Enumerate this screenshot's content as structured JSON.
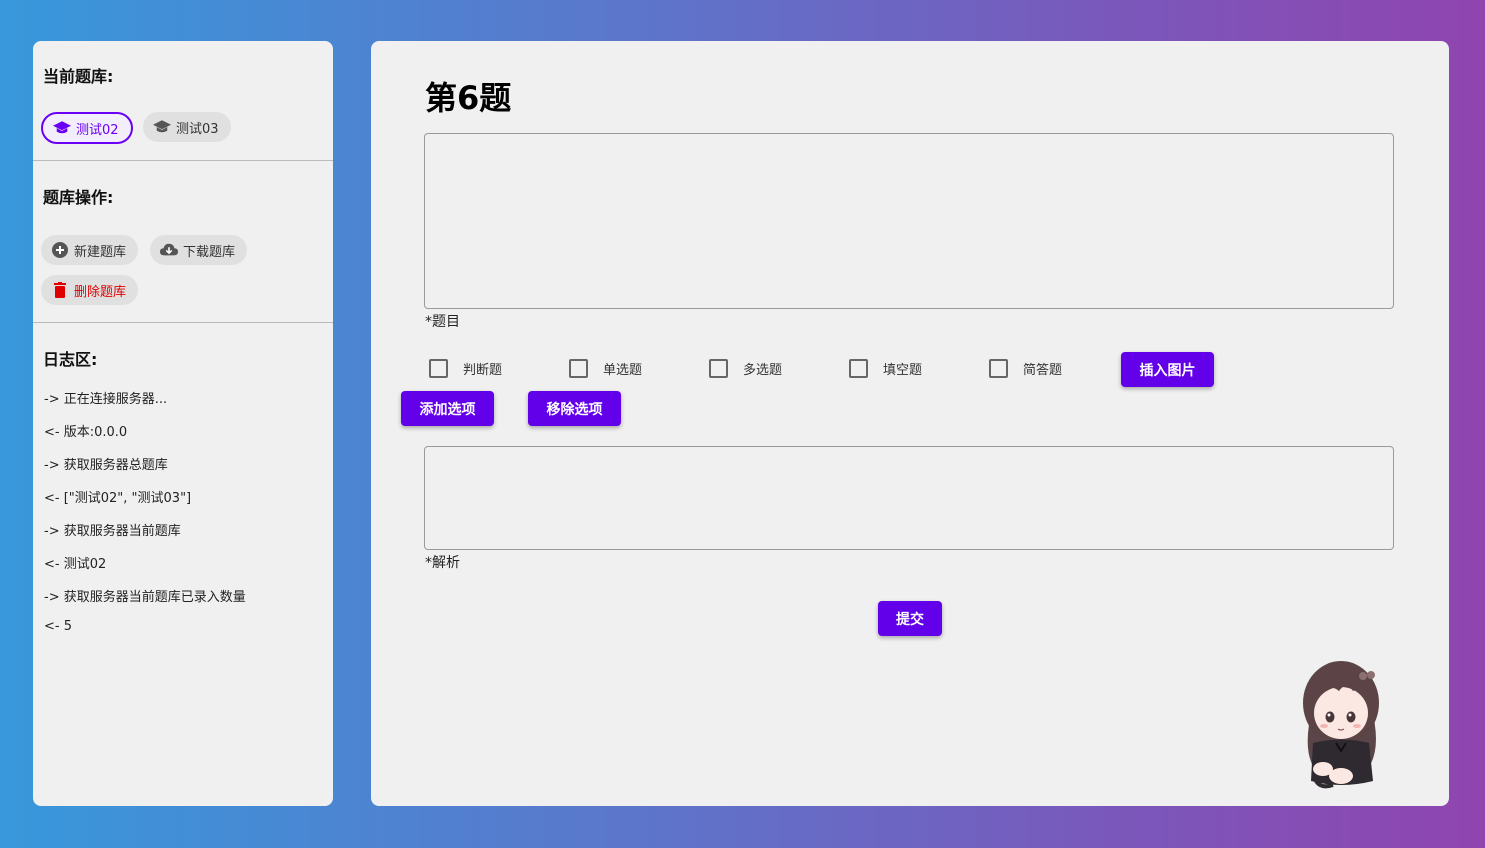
{
  "sidebar": {
    "current_bank_title": "当前题库:",
    "banks": [
      {
        "label": "测试02",
        "icon": "graduation-cap-icon",
        "selected": true
      },
      {
        "label": "测试03",
        "icon": "graduation-cap-icon",
        "selected": false
      }
    ],
    "ops_title": "题库操作:",
    "ops": {
      "new_label": "新建题库",
      "download_label": "下载题库",
      "delete_label": "删除题库"
    },
    "log_title": "日志区:",
    "log_lines": [
      "-> 正在连接服务器...",
      "<- 版本:0.0.0",
      "-> 获取服务器总题库",
      "<- [\"测试02\", \"测试03\"]",
      "-> 获取服务器当前题库",
      "<- 测试02",
      "-> 获取服务器当前题库已录入数量",
      "<- 5"
    ]
  },
  "main": {
    "question_title": "第6题",
    "question_label": "*题目",
    "types": [
      "判断题",
      "单选题",
      "多选题",
      "填空题",
      "简答题"
    ],
    "insert_image_label": "插入图片",
    "add_option_label": "添加选项",
    "remove_option_label": "移除选项",
    "analysis_label": "*解析",
    "submit_label": "提交"
  },
  "colors": {
    "accent": "#6200ea",
    "danger": "#e00000",
    "panel_bg": "#f0f0f0"
  }
}
